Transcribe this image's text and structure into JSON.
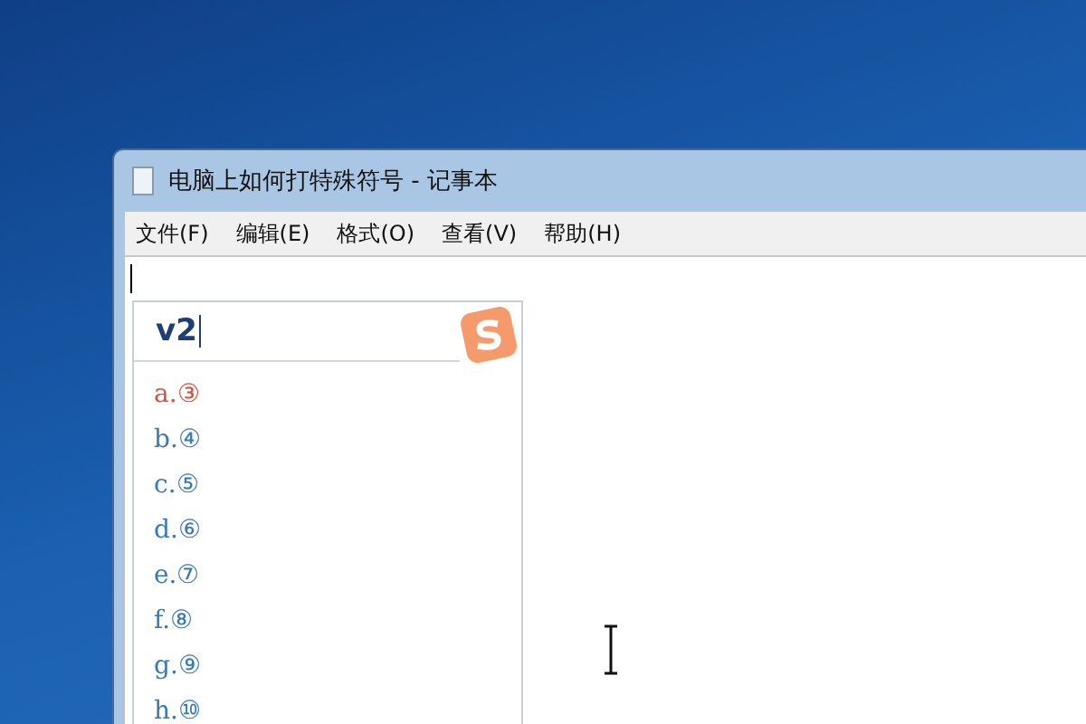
{
  "window": {
    "title": "电脑上如何打特殊符号 - 记事本"
  },
  "menu": [
    "文件(F)",
    "编辑(E)",
    "格式(O)",
    "查看(V)",
    "帮助(H)"
  ],
  "ime": {
    "input": "v2",
    "candidates": [
      {
        "text": "a.③",
        "selected": true
      },
      {
        "text": "b.④",
        "selected": false
      },
      {
        "text": "c.⑤",
        "selected": false
      },
      {
        "text": "d.⑥",
        "selected": false
      },
      {
        "text": "e.⑦",
        "selected": false
      },
      {
        "text": "f.⑧",
        "selected": false
      },
      {
        "text": "g.⑨",
        "selected": false
      },
      {
        "text": "h.⑩",
        "selected": false
      }
    ]
  }
}
